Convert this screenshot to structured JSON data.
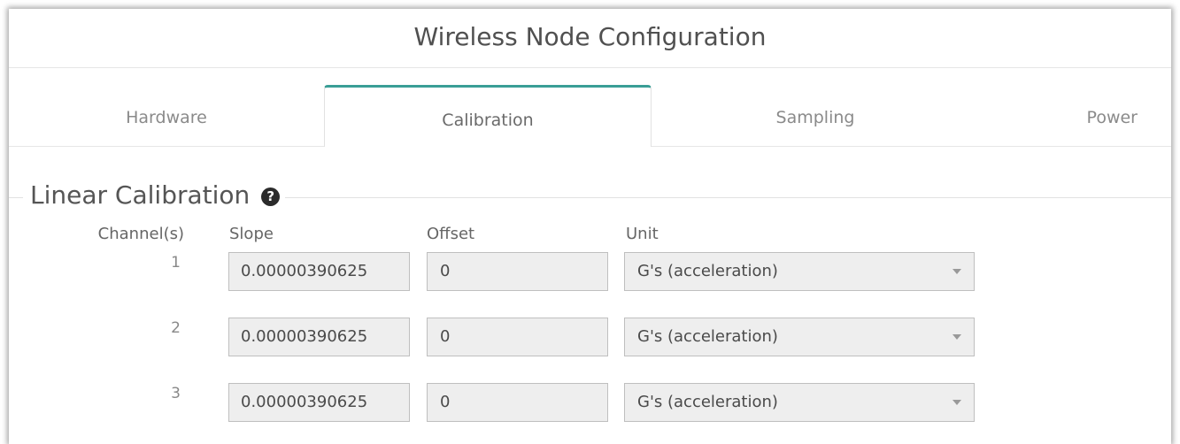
{
  "window": {
    "title": "Wireless Node Configuration"
  },
  "tabs": [
    {
      "label": "Hardware",
      "active": false
    },
    {
      "label": "Calibration",
      "active": true
    },
    {
      "label": "Sampling",
      "active": false
    },
    {
      "label": "Power",
      "active": false
    }
  ],
  "section": {
    "title": "Linear Calibration",
    "help_icon": "question-circle-icon",
    "help_glyph": "?"
  },
  "columns": {
    "channel": "Channel(s)",
    "slope": "Slope",
    "offset": "Offset",
    "unit": "Unit"
  },
  "rows": [
    {
      "channel": "1",
      "slope": "0.00000390625",
      "offset": "0",
      "unit": "G's (acceleration)"
    },
    {
      "channel": "2",
      "slope": "0.00000390625",
      "offset": "0",
      "unit": "G's (acceleration)"
    },
    {
      "channel": "3",
      "slope": "0.00000390625",
      "offset": "0",
      "unit": "G's (acceleration)"
    }
  ],
  "colors": {
    "active_tab_accent": "#3a9e96",
    "field_background": "#eeeeee",
    "help_icon": "#2b2b2b"
  }
}
